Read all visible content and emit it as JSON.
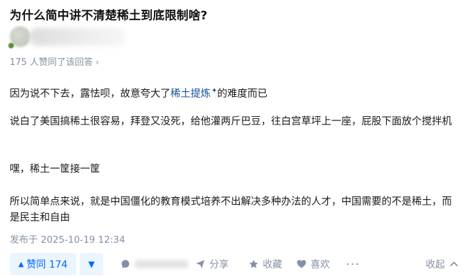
{
  "question": {
    "title": "为什么简中讲不清楚稀土到底限制啥?"
  },
  "author": {
    "avatar_icon": "avatar-icon"
  },
  "answer": {
    "likes_note": "175 人赞同了该回答",
    "likes_note_chevron": "›",
    "paragraphs": {
      "p1_before": "因为说不下去，露怯呗，故意夸大了",
      "p1_link": "稀土提炼",
      "p1_after": "的难度而已",
      "p2": "说白了美国搞稀土很容易，拜登又没死，给他灌两斤巴豆，往白宫草坪上一座，屁股下面放个搅拌机",
      "p3": "嘿，稀土一筐接一筐",
      "p4": "所以简单点来说，就是中国僵化的教育模式培养不出解决多种办法的人才，中国需要的不是稀土，而是民主和自由"
    },
    "timestamp": "发布于 2025-10-19 12:34"
  },
  "actions": {
    "vote_up_label": "赞同 174",
    "share_label": "分享",
    "favorite_label": "收藏",
    "like_label": "喜欢",
    "more_label": "···",
    "collapse_label": "收起"
  },
  "colors": {
    "accent": "#0066ff",
    "link": "#175199",
    "muted": "#8590a6",
    "vote_bg": "#ebf5ff"
  }
}
